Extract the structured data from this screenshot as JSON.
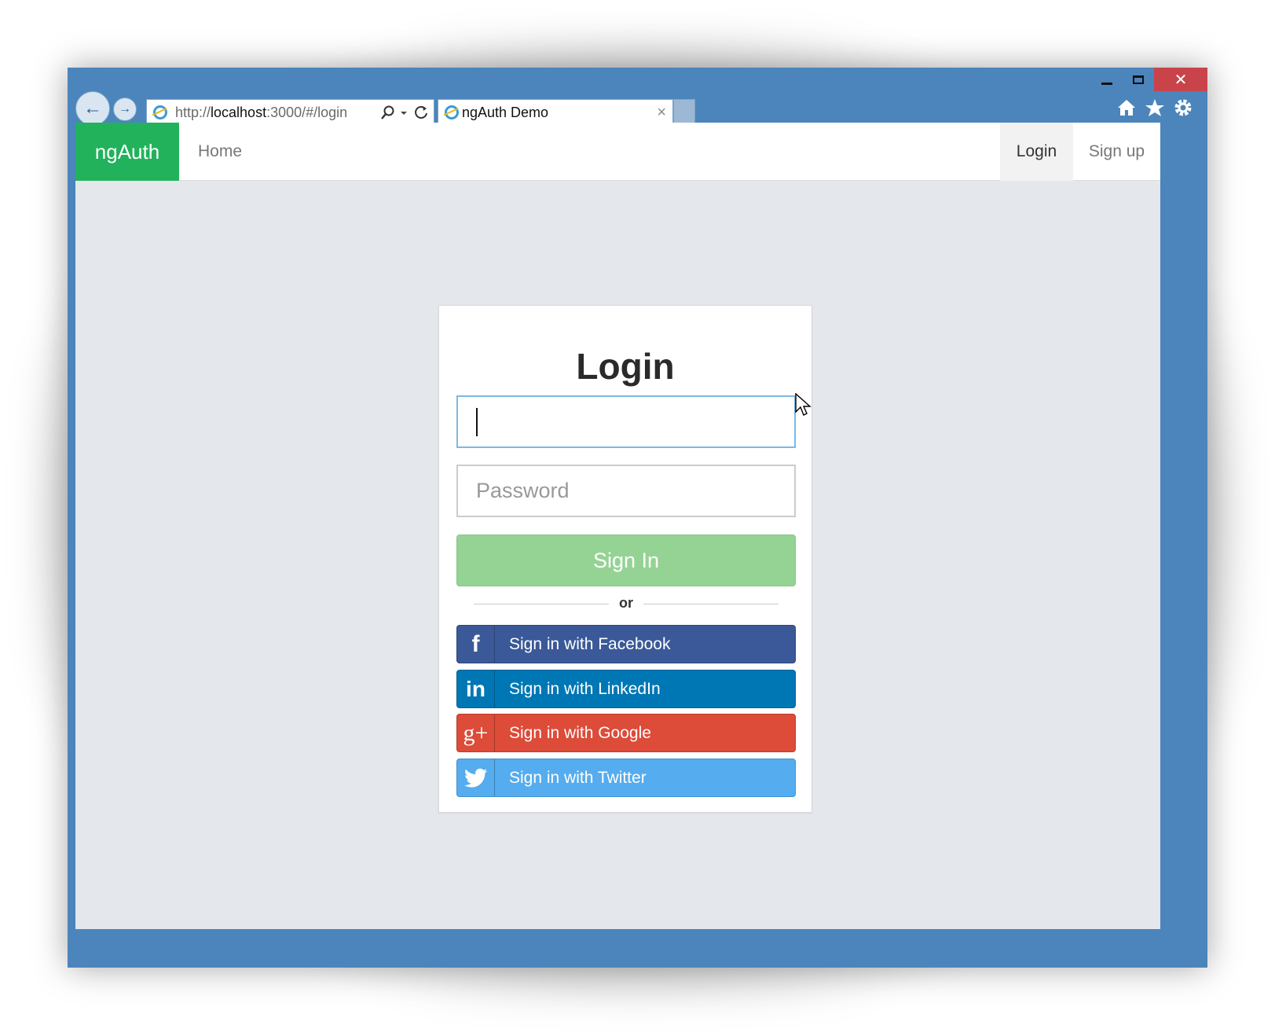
{
  "browser": {
    "address": {
      "prefix": "http://",
      "host": "localhost",
      "rest": ":3000/#/login"
    },
    "tab_title": "ngAuth Demo",
    "tab_close": "×",
    "window_close": "✕"
  },
  "navbar": {
    "brand": "ngAuth",
    "home": "Home",
    "login": "Login",
    "signup": "Sign up"
  },
  "login": {
    "title": "Login",
    "username_value": "",
    "password_placeholder": "Password",
    "signin_label": "Sign In",
    "divider": "or",
    "facebook_label": "Sign in with Facebook",
    "linkedin_label": "Sign in with LinkedIn",
    "google_label": "Sign in with Google",
    "twitter_label": "Sign in with Twitter"
  },
  "icons": {
    "facebook": "f",
    "linkedin": "in",
    "google": "g+",
    "twitter": "twitter-bird"
  },
  "colors": {
    "brand": "#22b25c",
    "signin": "#95d394",
    "facebook": "#3b5998",
    "linkedin": "#0077b5",
    "google": "#dd4b39",
    "twitter": "#55acee",
    "window_frame": "#4b85bb"
  }
}
